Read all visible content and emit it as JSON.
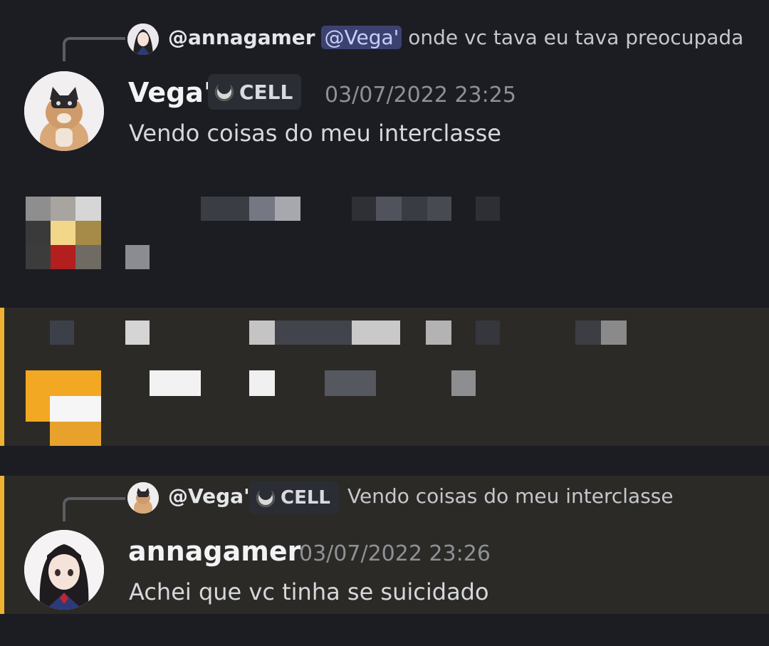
{
  "message1": {
    "reply": {
      "author": "@annagamer",
      "mention": "@Vega'",
      "text": "onde vc tava   eu tava preocupada"
    },
    "author": "Vega'",
    "badge": "CELL",
    "timestamp": "03/07/2022 23:25",
    "content": "Vendo coisas do meu interclasse"
  },
  "message2": {
    "reply": {
      "author": "@Vega'",
      "badge": "CELL",
      "text": "Vendo coisas do meu interclasse"
    },
    "author": "annagamer",
    "timestamp": "03/07/2022 23:26",
    "content": "Achei que vc tinha se suicidado"
  },
  "colors": {
    "background": "#1c1d22",
    "highlight_background": "#2c2a26",
    "highlight_bar": "#f0b232",
    "mention_bg": "#3c4270",
    "timestamp": "#8e9197"
  },
  "icons": [
    "cat-avatar",
    "anime-girl-avatar",
    "moon-badge-icon"
  ]
}
